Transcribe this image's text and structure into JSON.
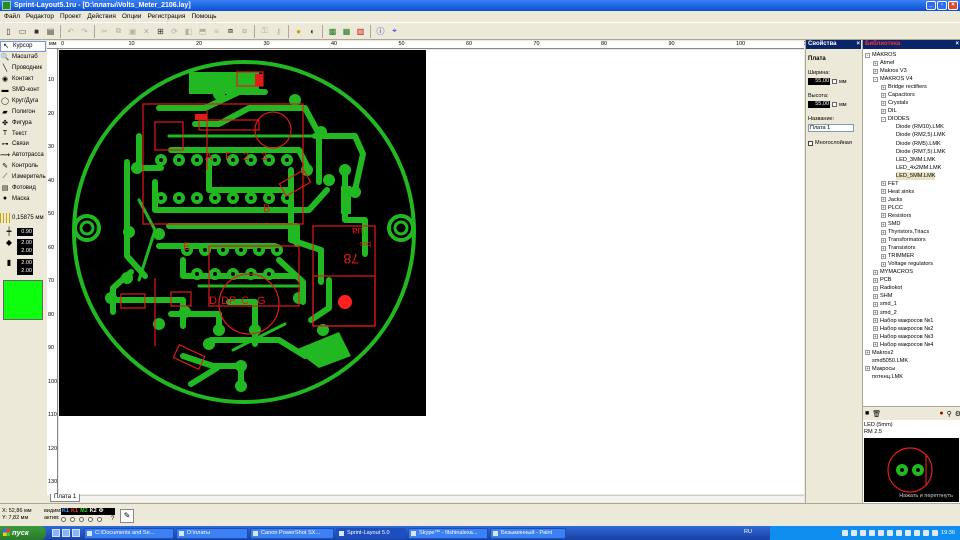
{
  "window": {
    "title": "Sprint-Layout5.1ru - [D:\\платы\\Volts_Meter_2106.lay]",
    "buttons": [
      "_",
      "▫",
      "×"
    ]
  },
  "menu": [
    "Файл",
    "Редактор",
    "Проект",
    "Действия",
    "Опции",
    "Регистрация",
    "Помощь"
  ],
  "tools": [
    {
      "label": "Курсор",
      "icon": "cursor-icon",
      "glyph": "↖",
      "selected": true
    },
    {
      "label": "Масштаб",
      "icon": "zoom-icon",
      "glyph": "🔍",
      "selected": false
    },
    {
      "label": "Проводник",
      "icon": "track-icon",
      "glyph": "╲",
      "selected": false
    },
    {
      "label": "Контакт",
      "icon": "pad-icon",
      "glyph": "◉",
      "selected": false
    },
    {
      "label": "SMD-конт",
      "icon": "smd-pad-icon",
      "glyph": "▬",
      "selected": false
    },
    {
      "label": "Круг/Дуга",
      "icon": "circle-icon",
      "glyph": "◯",
      "selected": false
    },
    {
      "label": "Полигон",
      "icon": "polygon-icon",
      "glyph": "▰",
      "selected": false
    },
    {
      "label": "Фигура",
      "icon": "shape-icon",
      "glyph": "✤",
      "selected": false
    },
    {
      "label": "Текст",
      "icon": "text-icon",
      "glyph": "T",
      "selected": false
    },
    {
      "label": "Связи",
      "icon": "connections-icon",
      "glyph": "⊶",
      "selected": false
    },
    {
      "label": "Автотрасса",
      "icon": "autoroute-icon",
      "glyph": "⟿",
      "selected": false
    },
    {
      "label": "Контроль",
      "icon": "check-icon",
      "glyph": "✎",
      "selected": false
    },
    {
      "label": "Измеритель",
      "icon": "measure-icon",
      "glyph": "⟋",
      "selected": false
    },
    {
      "label": "Фотовид",
      "icon": "photo-view-icon",
      "glyph": "▤",
      "selected": false
    },
    {
      "label": "Маска",
      "icon": "mask-icon",
      "glyph": "●",
      "selected": false
    }
  ],
  "grid": {
    "value": "0,15875 мм"
  },
  "spinners": [
    {
      "icon": "track-width-icon",
      "glyph": "┿",
      "value": "0.90"
    },
    {
      "icon": "pad-size-icon",
      "glyph": "◆",
      "value": "2.00",
      "value2": "2.00"
    },
    {
      "icon": "smd-size-icon",
      "glyph": "▮",
      "value": "2.00",
      "value2": "2.00"
    }
  ],
  "colors": {
    "active_layer": "#0dff0d",
    "board_bg": "#000000",
    "copper": "#22b822",
    "silkscreen": "#e01b1b",
    "header_bg": "#0a246a",
    "library_title": "#ff3333"
  },
  "ruler": {
    "unit": "мм",
    "h_ticks": [
      "0",
      "10",
      "20",
      "30",
      "40",
      "50",
      "60",
      "70",
      "80",
      "90",
      "100",
      "110"
    ],
    "v_ticks": [
      "10",
      "20",
      "30",
      "40",
      "50",
      "60",
      "70",
      "80",
      "90",
      "100",
      "110",
      "120",
      "130"
    ]
  },
  "sheet_tab": "Плата 1",
  "properties": {
    "header": "Свойства",
    "section": "Плата",
    "width_label": "Ширина:",
    "width_value": "55,00",
    "width_unit": "мм",
    "height_label": "Высота:",
    "height_value": "55,00",
    "height_unit": "мм",
    "name_label": "Название:",
    "name_value": "Плата 1",
    "multilayer_label": "Многослойная"
  },
  "library": {
    "header": "Библиотека",
    "tree": [
      {
        "label": "MAKROS",
        "depth": 0,
        "exp": "-"
      },
      {
        "label": "Atmel",
        "depth": 1,
        "exp": "+"
      },
      {
        "label": "Makros V3",
        "depth": 1,
        "exp": "+"
      },
      {
        "label": "MAKROS V4",
        "depth": 1,
        "exp": "-"
      },
      {
        "label": "Bridge rectifiers",
        "depth": 2,
        "exp": "+"
      },
      {
        "label": "Capacitors",
        "depth": 2,
        "exp": "+"
      },
      {
        "label": "Crystals",
        "depth": 2,
        "exp": "+"
      },
      {
        "label": "DIL",
        "depth": 2,
        "exp": "+"
      },
      {
        "label": "DIODES",
        "depth": 2,
        "exp": "-"
      },
      {
        "label": "Diode (RM10).LMK",
        "depth": 3,
        "exp": ""
      },
      {
        "label": "Diode (RM2,5).LMK",
        "depth": 3,
        "exp": ""
      },
      {
        "label": "Diode (RM5).LMK",
        "depth": 3,
        "exp": ""
      },
      {
        "label": "Diode (RM7,5).LMK",
        "depth": 3,
        "exp": ""
      },
      {
        "label": "LED_3MM.LMK",
        "depth": 3,
        "exp": ""
      },
      {
        "label": "LED_4x2MM.LMK",
        "depth": 3,
        "exp": ""
      },
      {
        "label": "LED_5MM.LMK",
        "depth": 3,
        "exp": "",
        "selected": true
      },
      {
        "label": "FET",
        "depth": 2,
        "exp": "+"
      },
      {
        "label": "Heat sinks",
        "depth": 2,
        "exp": "+"
      },
      {
        "label": "Jacks",
        "depth": 2,
        "exp": "+"
      },
      {
        "label": "PLCC",
        "depth": 2,
        "exp": "+"
      },
      {
        "label": "Resistors",
        "depth": 2,
        "exp": "+"
      },
      {
        "label": "SMD",
        "depth": 2,
        "exp": "+"
      },
      {
        "label": "Thyristors,Triacs",
        "depth": 2,
        "exp": "+"
      },
      {
        "label": "Transformators",
        "depth": 2,
        "exp": "+"
      },
      {
        "label": "Transistors",
        "depth": 2,
        "exp": "+"
      },
      {
        "label": "TRIMMER",
        "depth": 2,
        "exp": "+"
      },
      {
        "label": "Voltage regulators",
        "depth": 2,
        "exp": "+"
      },
      {
        "label": "MYMACROS",
        "depth": 1,
        "exp": "+"
      },
      {
        "label": "PCB",
        "depth": 1,
        "exp": "+"
      },
      {
        "label": "Radiokot",
        "depth": 1,
        "exp": "+"
      },
      {
        "label": "SHM",
        "depth": 1,
        "exp": "+"
      },
      {
        "label": "smd_1",
        "depth": 1,
        "exp": "+"
      },
      {
        "label": "smd_2",
        "depth": 1,
        "exp": "+"
      },
      {
        "label": "Набор макросов №1",
        "depth": 1,
        "exp": "+"
      },
      {
        "label": "Набор макросов №2",
        "depth": 1,
        "exp": "+"
      },
      {
        "label": "Набор макросов №3",
        "depth": 1,
        "exp": "+"
      },
      {
        "label": "Набор макросов №4",
        "depth": 1,
        "exp": "+"
      },
      {
        "label": "Makros2",
        "depth": 0,
        "exp": "+"
      },
      {
        "label": "smd5050.LMK",
        "depth": 0,
        "exp": ""
      },
      {
        "label": "Макросы",
        "depth": 0,
        "exp": "+"
      },
      {
        "label": "потенц.LMK",
        "depth": 0,
        "exp": ""
      }
    ],
    "info_name": "LED (5mm)",
    "info_rm": "RM 2.5",
    "preview_caption": "Нажать и перетянуть"
  },
  "board": {
    "silk_texts": [
      "A",
      "F",
      "2",
      "3",
      "B",
      "E",
      "D",
      "DP",
      "C",
      "G",
      "78",
      "ua",
      "bus"
    ]
  },
  "status": {
    "x_label": "X:",
    "x_value": "52,86 мм",
    "y_label": "Y:",
    "y_value": "7,82 мм",
    "visible_label": "видим:",
    "active_label": "актив:",
    "layers": [
      {
        "name": "K1",
        "color": "#4da6ff"
      },
      {
        "name": "K1",
        "color": "#ff3333"
      },
      {
        "name": "M2",
        "color": "#33cc33"
      },
      {
        "name": "K2",
        "color": "#ffffff"
      },
      {
        "name": "Ф",
        "color": "#ffffff"
      }
    ],
    "help": "?"
  },
  "taskbar": {
    "start": "пуск",
    "tasks": [
      "C:\\Documents and Se...",
      "D:\\платы",
      "Canon PowerShot SX...",
      "Sprint-Layout 5.0",
      "Skype™ - filshinalexa...",
      "Безымянный - Paint"
    ],
    "active_task": 3,
    "lang": "RU",
    "clock": "19:36"
  }
}
